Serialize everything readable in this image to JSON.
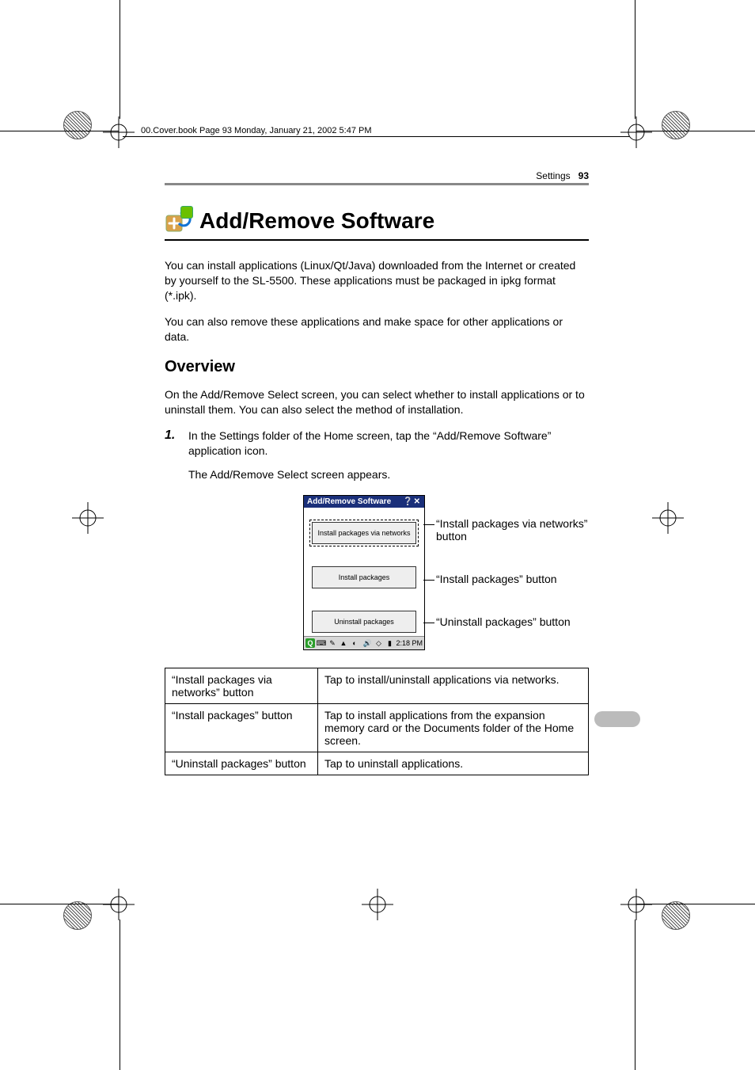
{
  "running_head": "00.Cover.book  Page 93  Monday, January 21, 2002  5:47 PM",
  "header": {
    "section": "Settings",
    "page_number": "93"
  },
  "title": "Add/Remove Software",
  "intro_para_1": "You can install applications (Linux/Qt/Java) downloaded from the Internet or created by yourself to the SL-5500. These applications must be packaged in ipkg format (*.ipk).",
  "intro_para_2": "You can also remove these applications and make space for other applications or data.",
  "overview_heading": "Overview",
  "overview_para": "On the Add/Remove Select screen, you can select whether to install applications or to uninstall them. You can also select the method of installation.",
  "step": {
    "num": "1.",
    "text": "In the Settings folder of the Home screen, tap the “Add/Remove Software” application icon.",
    "result": "The Add/Remove Select screen appears."
  },
  "screenshot": {
    "title": "Add/Remove Software",
    "btn1": "Install packages via networks",
    "btn2": "Install packages",
    "btn3": "Uninstall packages",
    "clock": "2:18 PM"
  },
  "callouts": {
    "c1": "“Install packages via networks” button",
    "c2": "“Install packages” button",
    "c3": "“Uninstall packages” button"
  },
  "table": {
    "rows": [
      {
        "label": "“Install packages via networks” button",
        "desc": "Tap to install/uninstall applications via networks."
      },
      {
        "label": "“Install packages” button",
        "desc": "Tap to install applications from the expansion memory card or the Documents folder of the Home screen."
      },
      {
        "label": "“Uninstall packages” button",
        "desc": "Tap to uninstall applications."
      }
    ]
  }
}
